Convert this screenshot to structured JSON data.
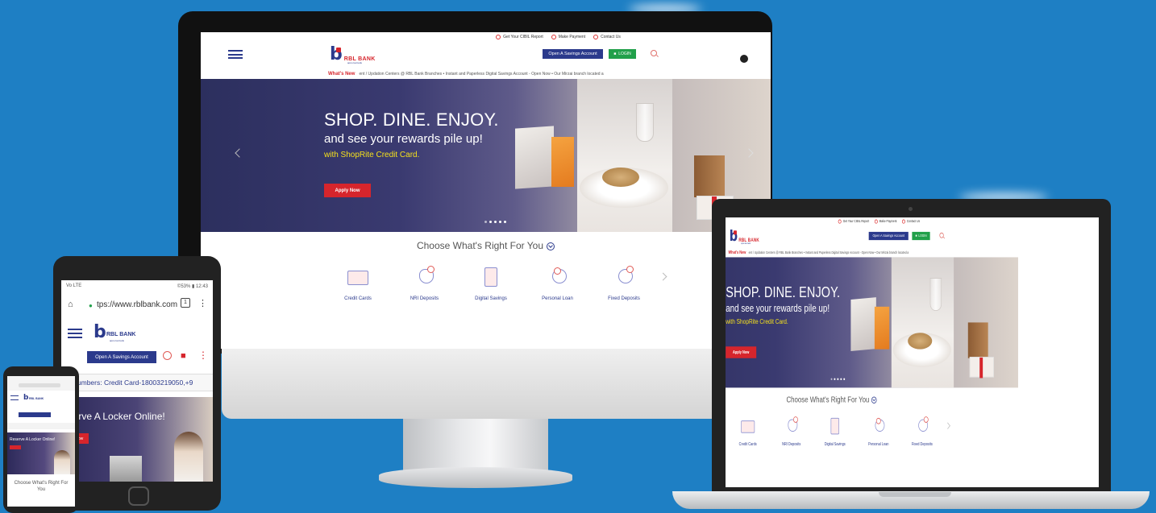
{
  "desktop": {
    "utility": [
      "Get Your CIBIL Report",
      "Make Payment",
      "Contact Us"
    ],
    "brand": "RBL BANK",
    "tagline": "apno ka bank",
    "open_account": "Open A Savings Account",
    "login": "LOGIN",
    "whats_new": "What's New",
    "ticker": "ent / Updation Centers @ RBL Bank Branches  •  Instant and Paperless Digital Savings Account - Open Now  •  Our Mirzai branch located a",
    "hero_title": "SHOP. DINE. ENJOY.",
    "hero_line2": "and see your rewards pile up!",
    "hero_line3": "with ShopRite Credit Card.",
    "apply": "Apply Now",
    "choose": "Choose What's Right For You",
    "products": [
      "Credit Cards",
      "NRI Deposits",
      "Digital Savings",
      "Personal Loan",
      "Fixed Deposits"
    ]
  },
  "tablet": {
    "status_left": "Vo LTE",
    "status_right": "©53% ▮ 12:43",
    "url": "tps://www.rblbank.com",
    "tab_count": "1",
    "brand": "RBL BANK",
    "tagline": "apno ka bank",
    "open_account": "Open A Savings Account",
    "ticker": "lumbers: Credit Card-18003219050,+9",
    "hero": "eserve A Locker Online!",
    "apply": "pply Now"
  },
  "phone": {
    "brand": "RBL BANK",
    "hero": "Reserve A Locker Online!",
    "choose": "Choose What's Right For",
    "choose2": "You"
  },
  "colors": {
    "background": "#1e7fc4",
    "brand_blue": "#2b3a8c",
    "brand_red": "#d6252c",
    "login_green": "#21a04a",
    "accent_yellow": "#f5e11c"
  }
}
